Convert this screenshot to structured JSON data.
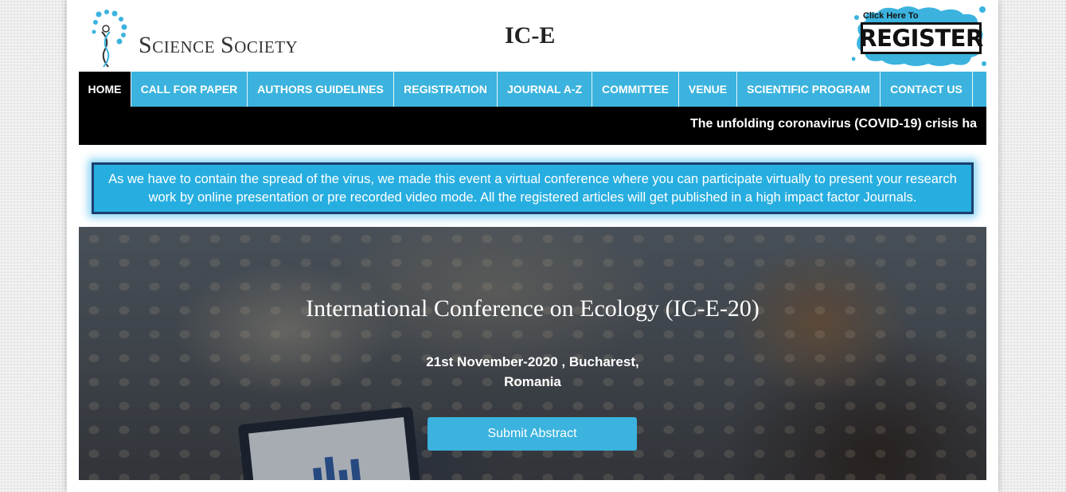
{
  "header": {
    "logo_text_first": "S",
    "logo_text_word1_rest": "cience",
    "logo_text_second": "S",
    "logo_text_word2_rest": "ociety",
    "site_title": "IC-E",
    "register_small": "Click Here To",
    "register_label": "REGISTER"
  },
  "nav": {
    "items": [
      {
        "label": "HOME",
        "active": true
      },
      {
        "label": "CALL FOR PAPER"
      },
      {
        "label": "AUTHORS GUIDELINES"
      },
      {
        "label": "REGISTRATION"
      },
      {
        "label": "JOURNAL A-Z"
      },
      {
        "label": "COMMITTEE"
      },
      {
        "label": "VENUE"
      },
      {
        "label": "SCIENTIFIC PROGRAM"
      },
      {
        "label": "CONTACT US"
      }
    ]
  },
  "ticker": {
    "text": "The unfolding coronavirus (COVID-19) crisis ha"
  },
  "notice": {
    "text": "As we have to contain the spread of the virus, we made this event a virtual conference where you can participate virtually to present your research work by online presentation or pre recorded video mode. All the registered articles will get published in a high impact factor Journals."
  },
  "hero": {
    "title": "International Conference on Ecology (IC-E-20)",
    "date_line1": "21st November-2020 , Bucharest,",
    "date_line2": "Romania",
    "submit_label": "Submit Abstract"
  },
  "colors": {
    "accent": "#3bb3de",
    "nav_active": "#000000",
    "notice_border": "#1c3f6e"
  }
}
